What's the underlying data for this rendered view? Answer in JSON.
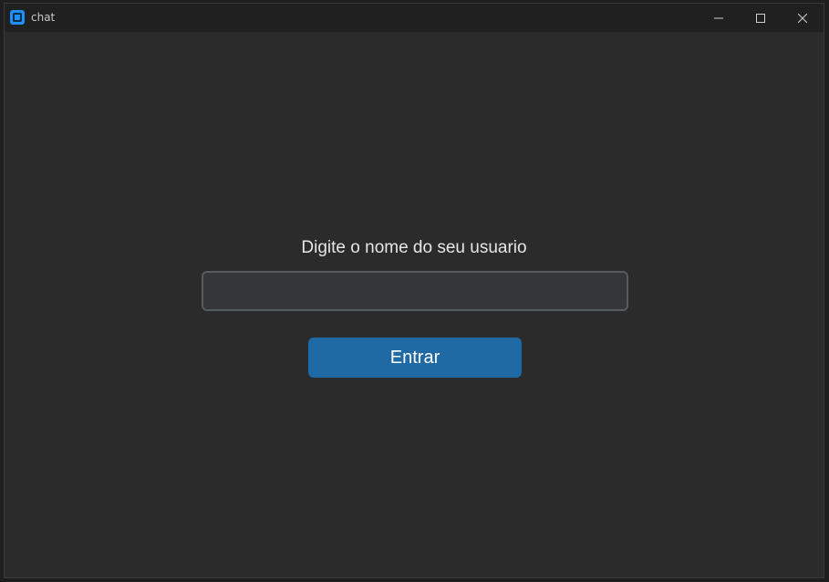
{
  "window": {
    "title": "chat",
    "icon": "app-icon",
    "controls": [
      "minimize-icon",
      "maximize-icon",
      "close-icon"
    ]
  },
  "login": {
    "prompt": "Digite o nome do seu usuario",
    "username_value": "",
    "username_placeholder": "",
    "enter_label": "Entrar"
  },
  "colors": {
    "background": "#2b2b2b",
    "titlebar": "#202020",
    "input_background": "#343638",
    "input_border": "#565b5e",
    "button": "#1f6aa5",
    "text": "#e6e6e6"
  }
}
